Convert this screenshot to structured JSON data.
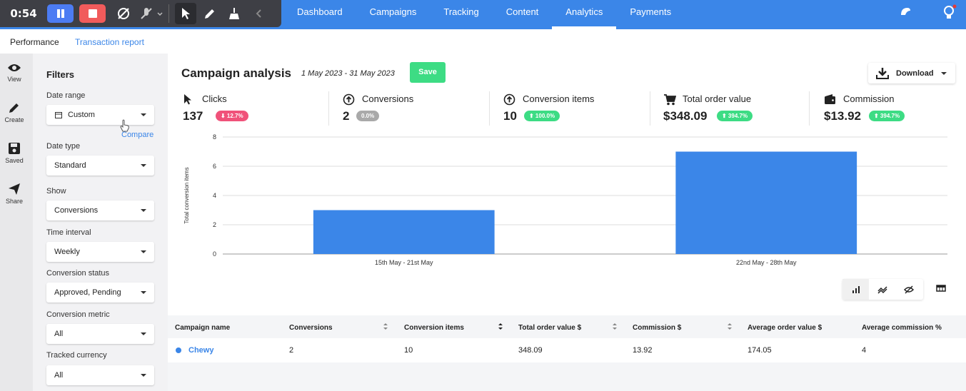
{
  "recorder": {
    "time": "0:54",
    "colors": {
      "pause": "#4c7cf3",
      "stop": "#f15b5b"
    },
    "tools": [
      "no-annotation-icon",
      "mic-off-icon",
      "cursor-icon",
      "pen-icon",
      "broom-icon",
      "chevron-left-icon"
    ]
  },
  "nav": {
    "tabs": [
      "Dashboard",
      "Campaigns",
      "Tracking",
      "Content",
      "Analytics",
      "Payments"
    ],
    "active": "Analytics"
  },
  "subnav": {
    "performance": "Performance",
    "transaction_report": "Transaction report"
  },
  "rail": {
    "view": "View",
    "create": "Create",
    "saved": "Saved",
    "share": "Share"
  },
  "filters": {
    "title": "Filters",
    "date_range_label": "Date range",
    "date_range_value": "Custom",
    "compare": "Compare",
    "date_type_label": "Date type",
    "date_type_value": "Standard",
    "show_label": "Show",
    "show_value": "Conversions",
    "time_interval_label": "Time interval",
    "time_interval_value": "Weekly",
    "conversion_status_label": "Conversion status",
    "conversion_status_value": "Approved, Pending",
    "conversion_metric_label": "Conversion metric",
    "conversion_metric_value": "All",
    "tracked_currency_label": "Tracked currency",
    "tracked_currency_value": "All"
  },
  "main": {
    "title": "Campaign analysis",
    "date_range": "1 May 2023 - 31 May 2023",
    "save": "Save",
    "download": "Download"
  },
  "kpis": [
    {
      "label": "Clicks",
      "value": "137",
      "badge": "⬇ 12.7%",
      "badge_color": "#f0527a",
      "icon": "cursor-icon"
    },
    {
      "label": "Conversions",
      "value": "2",
      "badge": "0.0%",
      "badge_color": "#a9a9a9",
      "icon": "up-arrow-circle-icon"
    },
    {
      "label": "Conversion items",
      "value": "10",
      "badge": "⬆ 100.0%",
      "badge_color": "#3ddc84",
      "icon": "up-arrow-circle-icon"
    },
    {
      "label": "Total order value",
      "value": "$348.09",
      "badge": "⬆ 394.7%",
      "badge_color": "#3ddc84",
      "icon": "cart-icon"
    },
    {
      "label": "Commission",
      "value": "$13.92",
      "badge": "⬆ 394.7%",
      "badge_color": "#3ddc84",
      "icon": "wallet-icon"
    }
  ],
  "chart_data": {
    "type": "bar",
    "categories": [
      "15th May - 21st May",
      "22nd May - 28th May"
    ],
    "values": [
      3,
      7
    ],
    "ylabel": "Total conversion items",
    "ylim": [
      0,
      8
    ],
    "yticks": [
      0,
      2,
      4,
      6,
      8
    ],
    "grid": true,
    "color": "#3b86e8"
  },
  "table": {
    "headers": [
      "Campaign name",
      "Conversions",
      "Conversion items",
      "Total order value $",
      "Commission $",
      "Average order value $",
      "Average commission %"
    ],
    "rows": [
      {
        "campaign": "Chewy",
        "conversions": "2",
        "conversion_items": "10",
        "total_order_value": "348.09",
        "commission": "13.92",
        "avg_order_value": "174.05",
        "avg_commission": "4"
      }
    ]
  }
}
